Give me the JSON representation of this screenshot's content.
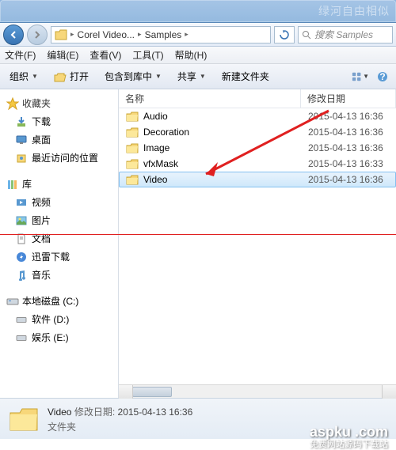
{
  "breadcrumbs": [
    "Corel Video...",
    "Samples"
  ],
  "search": {
    "placeholder": "搜索 Samples"
  },
  "menubar": [
    {
      "label": "文件(F)"
    },
    {
      "label": "编辑(E)"
    },
    {
      "label": "查看(V)"
    },
    {
      "label": "工具(T)"
    },
    {
      "label": "帮助(H)"
    }
  ],
  "toolbar": {
    "organize": "组织",
    "open": "打开",
    "include": "包含到库中",
    "share": "共享",
    "newfolder": "新建文件夹"
  },
  "sidebar": {
    "favorites": {
      "label": "收藏夹",
      "items": [
        "下载",
        "桌面",
        "最近访问的位置"
      ]
    },
    "libraries": {
      "label": "库",
      "items": [
        "视频",
        "图片",
        "文档",
        "迅雷下载",
        "音乐"
      ]
    },
    "drives": {
      "label": "本地磁盘 (C:)",
      "items": [
        "软件 (D:)",
        "娱乐 (E:)"
      ]
    }
  },
  "columns": {
    "name": "名称",
    "date": "修改日期"
  },
  "files": [
    {
      "name": "Audio",
      "date": "2015-04-13 16:36",
      "selected": false
    },
    {
      "name": "Decoration",
      "date": "2015-04-13 16:36",
      "selected": false
    },
    {
      "name": "Image",
      "date": "2015-04-13 16:36",
      "selected": false
    },
    {
      "name": "vfxMask",
      "date": "2015-04-13 16:33",
      "selected": false
    },
    {
      "name": "Video",
      "date": "2015-04-13 16:36",
      "selected": true
    }
  ],
  "status": {
    "name": "Video",
    "date_label": "修改日期:",
    "date": "2015-04-13 16:36",
    "type": "文件夹"
  },
  "watermark": {
    "main": "aspku .com",
    "sub": "免费网站源码下载站"
  }
}
